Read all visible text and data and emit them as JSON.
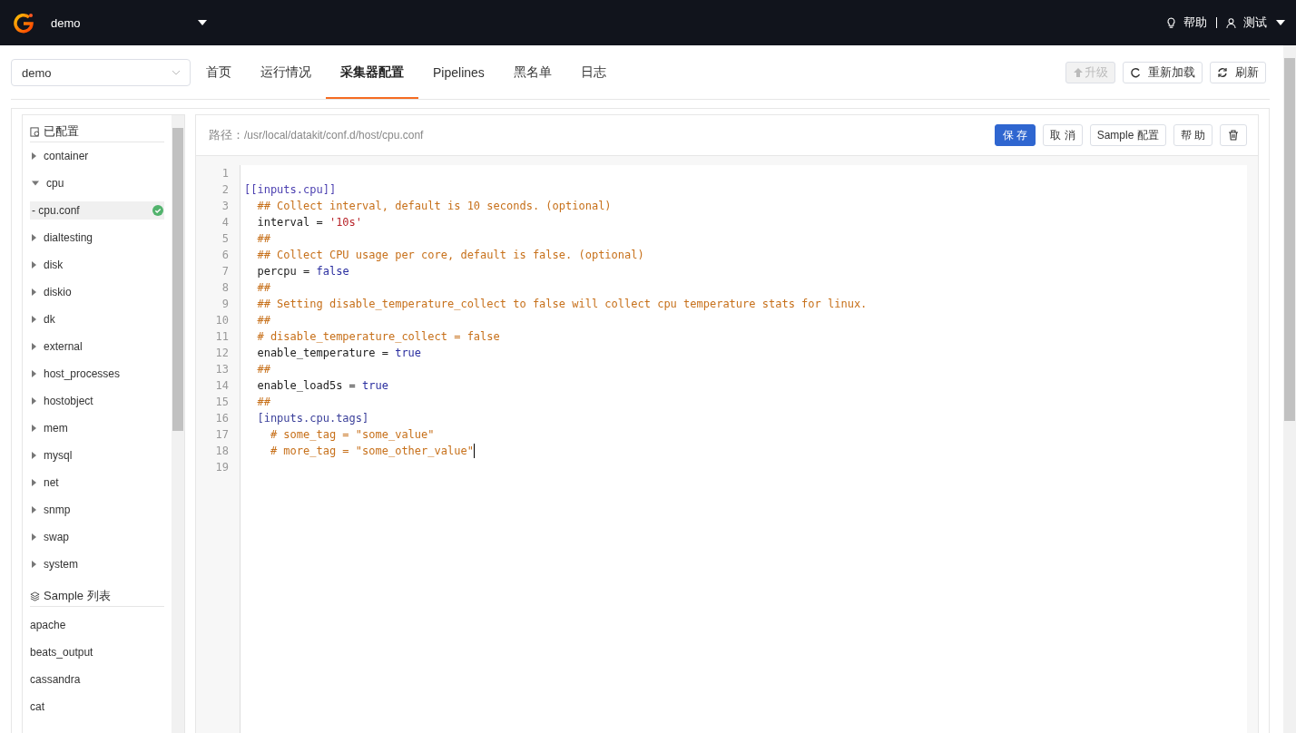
{
  "header": {
    "workspace": "demo",
    "help": "帮助",
    "user": "测试"
  },
  "toolbar": {
    "select_value": "demo",
    "tabs": [
      {
        "label": "首页",
        "selected": false
      },
      {
        "label": "运行情况",
        "selected": false
      },
      {
        "label": "采集器配置",
        "selected": true
      },
      {
        "label": "Pipelines",
        "selected": false
      },
      {
        "label": "黑名单",
        "selected": false
      },
      {
        "label": "日志",
        "selected": false
      }
    ],
    "actions": [
      {
        "label": "升级",
        "kind": "upgrade",
        "disabled": true
      },
      {
        "label": "重新加载",
        "kind": "reload",
        "disabled": false
      },
      {
        "label": "刷新",
        "kind": "refresh",
        "disabled": false
      }
    ]
  },
  "sidebar": {
    "configured_title": "已配置",
    "items": [
      {
        "label": "container",
        "expanded": false
      },
      {
        "label": "cpu",
        "expanded": true,
        "children": [
          {
            "label": "- cpu.conf",
            "selected": true,
            "valid": true
          }
        ]
      },
      {
        "label": "dialtesting",
        "expanded": false
      },
      {
        "label": "disk",
        "expanded": false
      },
      {
        "label": "diskio",
        "expanded": false
      },
      {
        "label": "dk",
        "expanded": false
      },
      {
        "label": "external",
        "expanded": false
      },
      {
        "label": "host_processes",
        "expanded": false
      },
      {
        "label": "hostobject",
        "expanded": false
      },
      {
        "label": "mem",
        "expanded": false
      },
      {
        "label": "mysql",
        "expanded": false
      },
      {
        "label": "net",
        "expanded": false
      },
      {
        "label": "snmp",
        "expanded": false
      },
      {
        "label": "swap",
        "expanded": false
      },
      {
        "label": "system",
        "expanded": false
      }
    ],
    "samples_title": "Sample 列表",
    "samples": [
      "apache",
      "beats_output",
      "cassandra",
      "cat"
    ]
  },
  "editor": {
    "path_label": "路径：",
    "path": "/usr/local/datakit/conf.d/host/cpu.conf",
    "buttons": [
      {
        "label": "保 存",
        "kind": "primary"
      },
      {
        "label": "取 消",
        "kind": "default"
      },
      {
        "label": "Sample 配置",
        "kind": "default"
      },
      {
        "label": "帮 助",
        "kind": "default"
      },
      {
        "kind": "delete"
      }
    ],
    "lines": [
      {
        "number": "1"
      },
      {
        "number": "2",
        "tokens": [
          {
            "kind": "section",
            "text": "[[inputs.cpu]]"
          }
        ]
      },
      {
        "number": "3",
        "tokens": [
          {
            "kind": "comment",
            "text": "  ## Collect interval, default is 10 seconds. (optional)"
          }
        ]
      },
      {
        "number": "4",
        "tokens": [
          {
            "kind": "plain",
            "text": "  interval = "
          },
          {
            "kind": "string",
            "text": "'10s'"
          }
        ]
      },
      {
        "number": "5",
        "tokens": [
          {
            "kind": "comment",
            "text": "  ##"
          }
        ]
      },
      {
        "number": "6",
        "tokens": [
          {
            "kind": "comment",
            "text": "  ## Collect CPU usage per core, default is false. (optional)"
          }
        ]
      },
      {
        "number": "7",
        "tokens": [
          {
            "kind": "plain",
            "text": "  percpu = "
          },
          {
            "kind": "keyword",
            "text": "false"
          }
        ]
      },
      {
        "number": "8",
        "tokens": [
          {
            "kind": "comment",
            "text": "  ##"
          }
        ]
      },
      {
        "number": "9",
        "tokens": [
          {
            "kind": "comment",
            "text": "  ## Setting disable_temperature_collect to false will collect cpu temperature stats for linux."
          }
        ]
      },
      {
        "number": "10",
        "tokens": [
          {
            "kind": "comment",
            "text": "  ##"
          }
        ]
      },
      {
        "number": "11",
        "tokens": [
          {
            "kind": "comment",
            "text": "  # disable_temperature_collect = false"
          }
        ]
      },
      {
        "number": "12",
        "tokens": [
          {
            "kind": "plain",
            "text": "  enable_temperature = "
          },
          {
            "kind": "keyword",
            "text": "true"
          }
        ]
      },
      {
        "number": "13",
        "tokens": [
          {
            "kind": "comment",
            "text": "  ##"
          }
        ]
      },
      {
        "number": "14",
        "tokens": [
          {
            "kind": "plain",
            "text": "  enable_load5s = "
          },
          {
            "kind": "keyword",
            "text": "true"
          }
        ]
      },
      {
        "number": "15",
        "tokens": [
          {
            "kind": "comment",
            "text": "  ##"
          }
        ]
      },
      {
        "number": "16",
        "tokens": [
          {
            "kind": "section2",
            "text": "  [inputs.cpu.tags]"
          }
        ]
      },
      {
        "number": "17",
        "tokens": [
          {
            "kind": "comment",
            "text": "    # some_tag = \"some_value\""
          }
        ]
      },
      {
        "number": "18",
        "tokens": [
          {
            "kind": "comment",
            "text": "    # more_tag = \"some_other_value\""
          }
        ],
        "cursor": true
      },
      {
        "number": "19"
      }
    ]
  }
}
